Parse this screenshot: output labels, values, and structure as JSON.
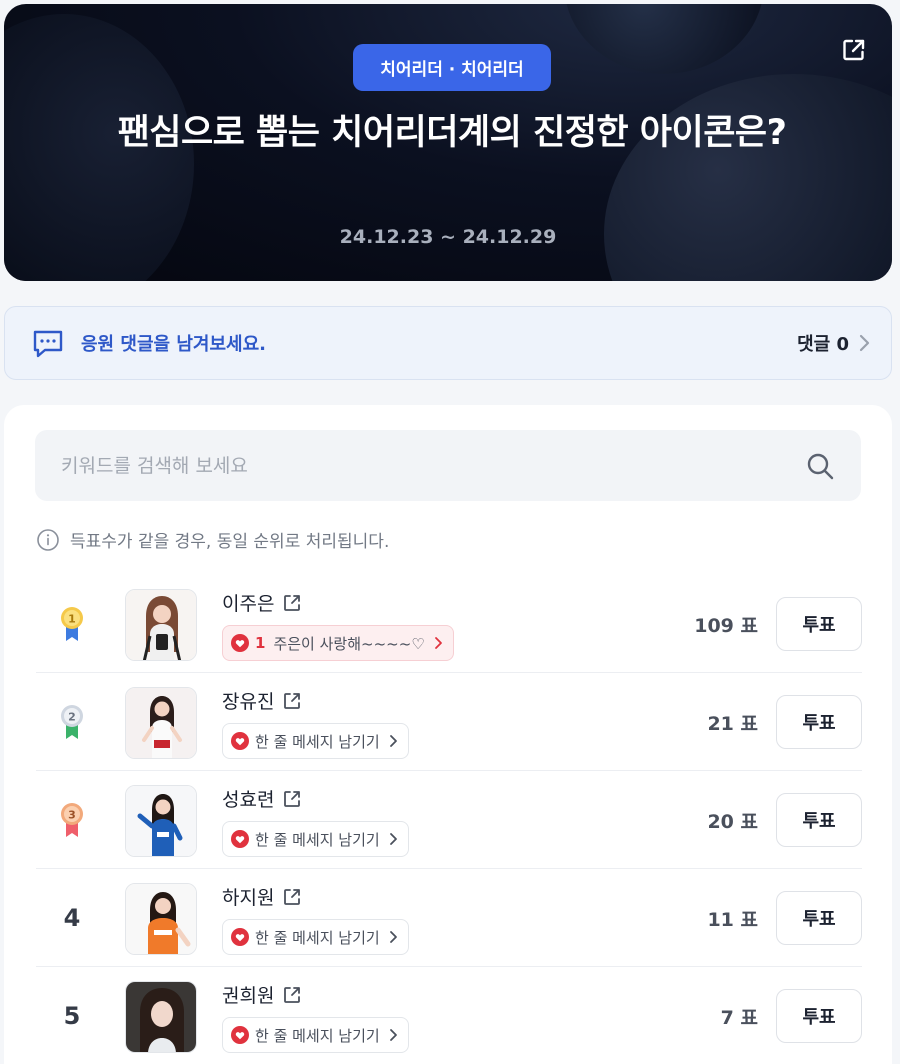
{
  "hero": {
    "category": "치어리더 · 치어리더",
    "title": "팬심으로 뽑는 치어리더계의 진정한 아이콘은?",
    "period": "24.12.23 ~ 24.12.29",
    "share_icon": "share-external-icon"
  },
  "comments": {
    "prompt": "응원 댓글을 남겨보세요.",
    "count_label": "댓글 0",
    "icon": "chat-bubble-icon"
  },
  "search": {
    "placeholder": "키워드를 검색해 보세요",
    "icon": "search-icon"
  },
  "notice": "득표수가 같을 경우, 동일 순위로 처리됩니다.",
  "vote_label": "투표",
  "colors": {
    "accent": "#3a66e8",
    "gold": "#f5c94a",
    "silver": "#cfd6e0",
    "bronze": "#f2a97b",
    "heart": "#e0323e"
  },
  "candidates": [
    {
      "rank": "1",
      "medal": "gold",
      "name": "이주은",
      "message_count": "1",
      "message": "주은이 사랑해~~~~♡",
      "votes": "109 표"
    },
    {
      "rank": "2",
      "medal": "silver",
      "name": "장유진",
      "message_count": "",
      "message": "한 줄 메세지 남기기",
      "votes": "21 표"
    },
    {
      "rank": "3",
      "medal": "bronze",
      "name": "성효련",
      "message_count": "",
      "message": "한 줄 메세지 남기기",
      "votes": "20 표"
    },
    {
      "rank": "4",
      "medal": "",
      "name": "하지원",
      "message_count": "",
      "message": "한 줄 메세지 남기기",
      "votes": "11 표"
    },
    {
      "rank": "5",
      "medal": "",
      "name": "권희원",
      "message_count": "",
      "message": "한 줄 메세지 남기기",
      "votes": "7 표"
    }
  ]
}
